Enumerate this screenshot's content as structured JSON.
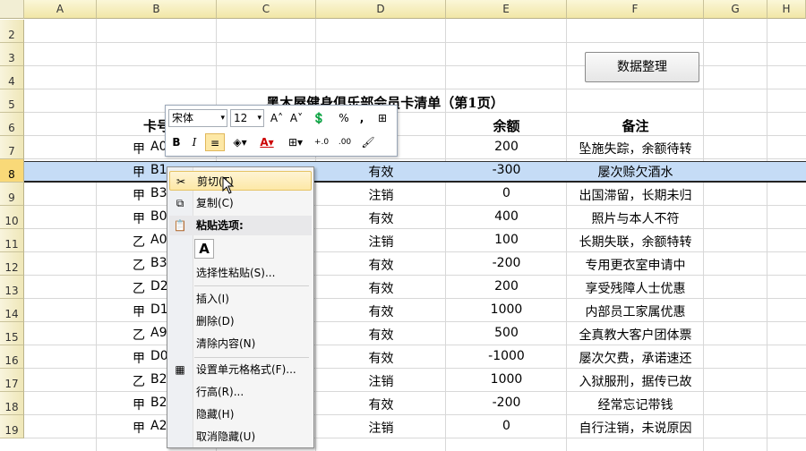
{
  "columns": [
    "A",
    "B",
    "C",
    "D",
    "E",
    "F",
    "G",
    "H"
  ],
  "rows": [
    "2",
    "3",
    "4",
    "5",
    "6",
    "7",
    "8",
    "9",
    "10",
    "11",
    "12",
    "13",
    "14",
    "15",
    "16",
    "17",
    "18",
    "19"
  ],
  "button": {
    "label": "数据整理"
  },
  "title": "黑木屋健身俱乐部会员卡清单（第1页）",
  "headers": {
    "card": "卡号",
    "balance": "余额",
    "remark": "备注"
  },
  "data_rows": [
    {
      "prefix": "甲",
      "card": "A0",
      "status": "",
      "balance": "200",
      "remark": "坠施失踪，余额待转"
    },
    {
      "prefix": "甲",
      "card": "B1",
      "status": "有效",
      "balance": "-300",
      "remark": "屡次赊欠酒水"
    },
    {
      "prefix": "甲",
      "card": "B3",
      "status": "注销",
      "balance": "0",
      "remark": "出国滞留，长期未归"
    },
    {
      "prefix": "甲",
      "card": "B0",
      "status": "有效",
      "balance": "400",
      "remark": "照片与本人不符"
    },
    {
      "prefix": "乙",
      "card": "A0",
      "status": "注销",
      "balance": "100",
      "remark": "长期失联，余额特转"
    },
    {
      "prefix": "乙",
      "card": "B3",
      "status": "有效",
      "balance": "-200",
      "remark": "专用更衣室申请中"
    },
    {
      "prefix": "乙",
      "card": "D2",
      "status": "有效",
      "balance": "200",
      "remark": "享受残障人士优惠"
    },
    {
      "prefix": "甲",
      "card": "D1",
      "status": "有效",
      "balance": "1000",
      "remark": "内部员工家属优惠"
    },
    {
      "prefix": "乙",
      "card": "A9",
      "status": "有效",
      "balance": "500",
      "remark": "全真教大客户团体票"
    },
    {
      "prefix": "甲",
      "card": "D0",
      "status": "有效",
      "balance": "-1000",
      "remark": "屡次欠费，承诺速还"
    },
    {
      "prefix": "乙",
      "card": "B2",
      "status": "注销",
      "balance": "1000",
      "remark": "入狱服刑，据传已故"
    },
    {
      "prefix": "甲",
      "card": "B2",
      "status": "有效",
      "balance": "-200",
      "remark": "经常忘记带钱"
    },
    {
      "prefix": "甲",
      "card": "A2",
      "status": "注销",
      "balance": "0",
      "remark": "自行注销，未说原因"
    }
  ],
  "mini_toolbar": {
    "font_name": "宋体",
    "font_size": "12",
    "grow_font": "A˄",
    "shrink_font": "A˅",
    "currency": "💲",
    "percent": "%",
    "comma": ",",
    "bold": "B",
    "italic": "I",
    "font_color_letter": "A",
    "inc_decimal": "+.0",
    "dec_decimal": ".00"
  },
  "context_menu": {
    "cut": "剪切(T)",
    "copy": "复制(C)",
    "paste_options": "粘贴选项:",
    "paste_icon": "A",
    "paste_special": "选择性粘贴(S)...",
    "insert": "插入(I)",
    "delete": "删除(D)",
    "clear": "清除内容(N)",
    "format_cells": "设置单元格格式(F)...",
    "row_height": "行高(R)...",
    "hide": "隐藏(H)",
    "unhide": "取消隐藏(U)"
  },
  "colors": {
    "selection": "#c5dcf6",
    "header": "#f1e6a6",
    "menu_highlight": "#fde8a6"
  }
}
